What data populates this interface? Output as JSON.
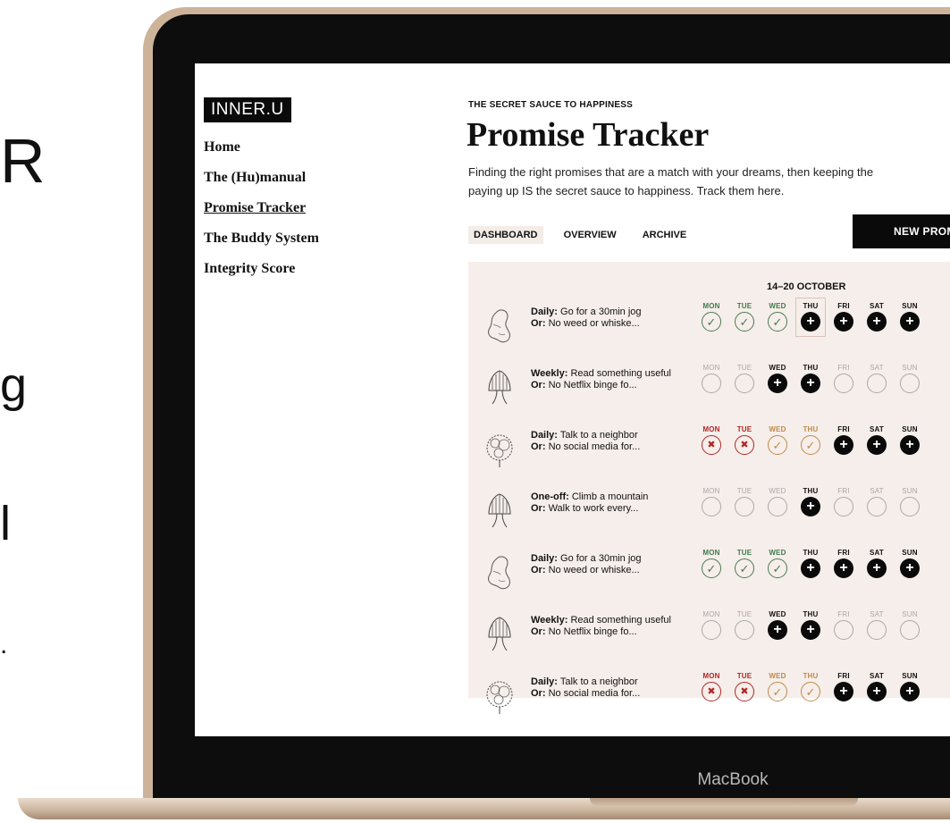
{
  "side_text": {
    "r": "R",
    "g": "g",
    "l": "l",
    "dot": "."
  },
  "laptop": {
    "brand": "MacBook"
  },
  "app": {
    "logo": "INNER.U",
    "nav": [
      {
        "label": "Home",
        "active": false
      },
      {
        "label": "The (Hu)manual",
        "active": false
      },
      {
        "label": "Promise Tracker",
        "active": true
      },
      {
        "label": "The Buddy System",
        "active": false
      },
      {
        "label": "Integrity Score",
        "active": false
      }
    ],
    "eyebrow": "THE SECRET SAUCE TO HAPPINESS",
    "title": "Promise Tracker",
    "description_line1": "Finding the right promises that are a match with your dreams, then keeping the",
    "description_line2": "paying up IS the secret sauce to happiness. Track them here.",
    "tabs": [
      {
        "label": "DASHBOARD",
        "active": true
      },
      {
        "label": "OVERVIEW",
        "active": false
      },
      {
        "label": "ARCHIVE",
        "active": false
      }
    ],
    "new_button": "NEW PROMI",
    "week_label": "14–20 OCTOBER",
    "days": [
      "MON",
      "TUE",
      "WED",
      "THU",
      "FRI",
      "SAT",
      "SUN"
    ],
    "promises": [
      {
        "type": "Daily:",
        "text": "Go for a 30min jog",
        "or_label": "Or:",
        "or_text": "No weed or whiske...",
        "illustration": "figure-icon",
        "statuses": [
          "check-g",
          "check-g",
          "check-g",
          "plus",
          "plus",
          "plus",
          "plus"
        ],
        "label_colors": [
          "green",
          "green",
          "green",
          "black",
          "black",
          "black",
          "black"
        ]
      },
      {
        "type": "Weekly:",
        "text": "Read something useful",
        "or_label": "Or:",
        "or_text": "No Netflix binge fo...",
        "illustration": "tree-icon",
        "statuses": [
          "empty",
          "empty",
          "plus",
          "plus",
          "empty",
          "empty",
          "empty"
        ],
        "label_colors": [
          "gray",
          "gray",
          "black",
          "black",
          "gray",
          "gray",
          "gray"
        ]
      },
      {
        "type": "Daily:",
        "text": "Talk to a neighbor",
        "or_label": "Or:",
        "or_text": "No social media for...",
        "illustration": "bush-icon",
        "statuses": [
          "x",
          "x",
          "check-o",
          "check-o",
          "plus",
          "plus",
          "plus"
        ],
        "label_colors": [
          "red",
          "red",
          "orange",
          "orange",
          "black",
          "black",
          "black"
        ]
      },
      {
        "type": "One-off:",
        "text": "Climb a mountain",
        "or_label": "Or:",
        "or_text": "Walk to work every...",
        "illustration": "tree-icon",
        "statuses": [
          "empty",
          "empty",
          "empty",
          "plus",
          "empty",
          "empty",
          "empty"
        ],
        "label_colors": [
          "gray",
          "gray",
          "gray",
          "black",
          "gray",
          "gray",
          "gray"
        ]
      },
      {
        "type": "Daily:",
        "text": "Go for a 30min jog",
        "or_label": "Or:",
        "or_text": "No weed or whiske...",
        "illustration": "figure-icon",
        "statuses": [
          "check-g",
          "check-g",
          "check-g",
          "plus",
          "plus",
          "plus",
          "plus"
        ],
        "label_colors": [
          "green",
          "green",
          "green",
          "black",
          "black",
          "black",
          "black"
        ]
      },
      {
        "type": "Weekly:",
        "text": "Read something useful",
        "or_label": "Or:",
        "or_text": "No Netflix binge fo...",
        "illustration": "tree-icon",
        "statuses": [
          "empty",
          "empty",
          "plus",
          "plus",
          "empty",
          "empty",
          "empty"
        ],
        "label_colors": [
          "gray",
          "gray",
          "black",
          "black",
          "gray",
          "gray",
          "gray"
        ]
      },
      {
        "type": "Daily:",
        "text": "Talk to a neighbor",
        "or_label": "Or:",
        "or_text": "No social media for...",
        "illustration": "bush-icon",
        "statuses": [
          "x",
          "x",
          "check-o",
          "check-o",
          "plus",
          "plus",
          "plus"
        ],
        "label_colors": [
          "red",
          "red",
          "orange",
          "orange",
          "black",
          "black",
          "black"
        ]
      }
    ]
  }
}
